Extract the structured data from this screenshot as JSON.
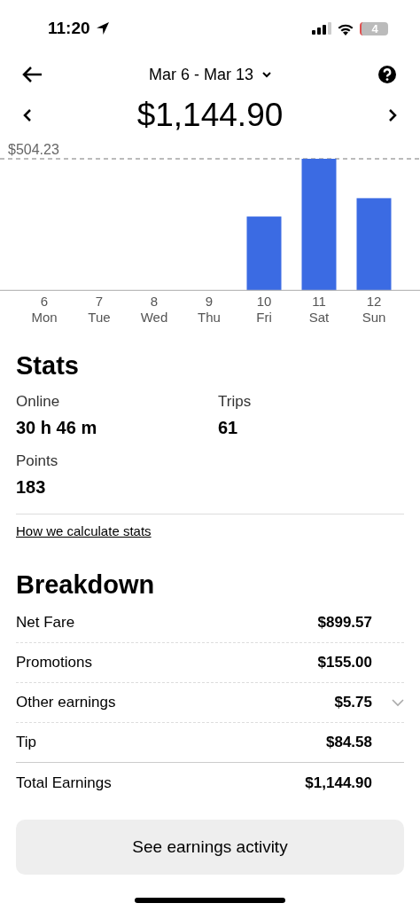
{
  "status_bar": {
    "time": "11:20",
    "battery": "4"
  },
  "header": {
    "date_range": "Mar 6 - Mar 13"
  },
  "total": "$1,144.90",
  "chart": {
    "max_label": "$504.23",
    "days": [
      {
        "date": "6",
        "weekday": "Mon"
      },
      {
        "date": "7",
        "weekday": "Tue"
      },
      {
        "date": "8",
        "weekday": "Wed"
      },
      {
        "date": "9",
        "weekday": "Thu"
      },
      {
        "date": "10",
        "weekday": "Fri"
      },
      {
        "date": "11",
        "weekday": "Sat"
      },
      {
        "date": "12",
        "weekday": "Sun"
      }
    ]
  },
  "stats": {
    "title": "Stats",
    "items": [
      {
        "label": "Online",
        "value": "30 h 46 m"
      },
      {
        "label": "Trips",
        "value": "61"
      },
      {
        "label": "Points",
        "value": "183"
      }
    ],
    "link": "How we calculate stats"
  },
  "breakdown": {
    "title": "Breakdown",
    "rows": [
      {
        "kind": "item",
        "label": "Net Fare",
        "value": "$899.57"
      },
      {
        "kind": "item",
        "label": "Promotions",
        "value": "$155.00"
      },
      {
        "kind": "expandable",
        "label": "Other earnings",
        "value": "$5.75",
        "expanded": false
      },
      {
        "kind": "item",
        "label": "Tip",
        "value": "$84.58"
      },
      {
        "kind": "total",
        "label": "Total Earnings",
        "value": "$1,144.90"
      }
    ]
  },
  "button": "See earnings activity"
}
